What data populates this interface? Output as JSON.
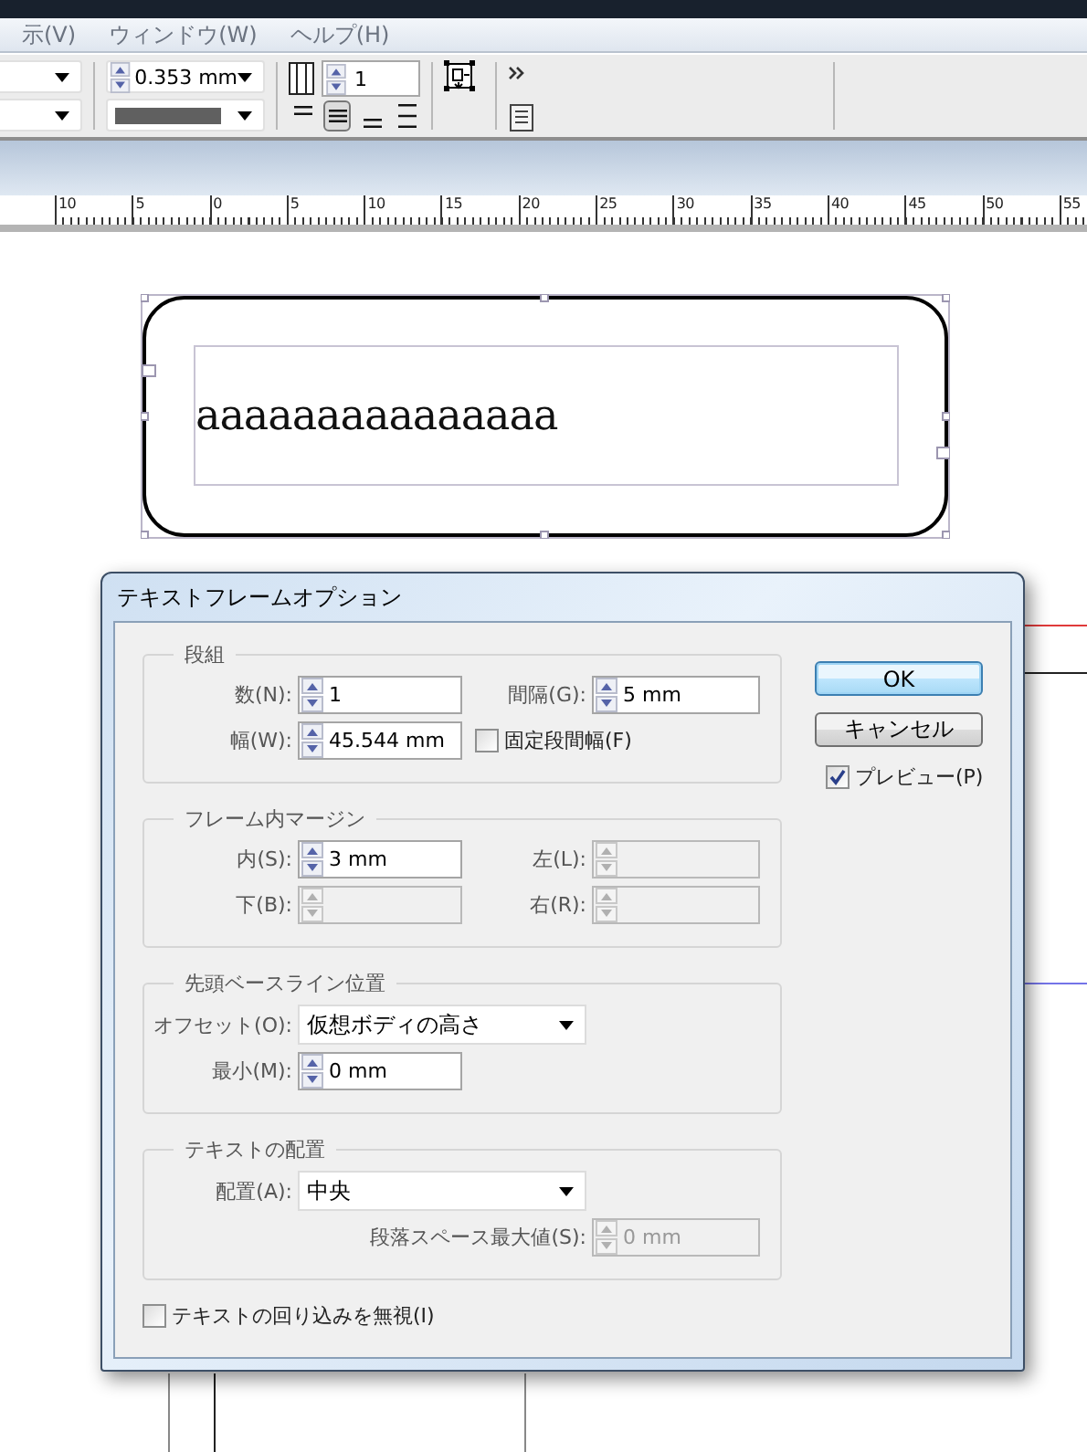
{
  "menu_bar": {
    "items": [
      "示(V)",
      "ウィンドウ(W)",
      "ヘルプ(H)"
    ]
  },
  "control_panel": {
    "stroke_weight": "0.353 mm",
    "column_count": "1",
    "alignment_buttons": [
      {
        "kind": "top",
        "selected": false
      },
      {
        "kind": "center",
        "selected": true
      },
      {
        "kind": "bottom",
        "selected": false
      },
      {
        "kind": "justify",
        "selected": false
      }
    ]
  },
  "ruler": {
    "labels": [
      "10",
      "5",
      "0",
      "5",
      "10",
      "15",
      "20",
      "25",
      "30",
      "35",
      "40",
      "45",
      "50",
      "55"
    ]
  },
  "canvas": {
    "frame_text": "aaaaaaaaaaaaaaa"
  },
  "dialog": {
    "title": "テキストフレームオプション",
    "sections": [
      {
        "title": "段組",
        "rows": [
          {
            "left": {
              "kind": "spin",
              "label": "数(N):",
              "value": "1",
              "disabled": false
            },
            "right": {
              "kind": "spin",
              "label": "間隔(G):",
              "value": "5 mm",
              "disabled": false
            }
          },
          {
            "left": {
              "kind": "spin",
              "label": "幅(W):",
              "value": "45.544 mm",
              "disabled": false
            },
            "right": {
              "kind": "checkbox",
              "label": "固定段間幅(F)",
              "checked": false
            }
          }
        ]
      },
      {
        "title": "フレーム内マージン",
        "rows": [
          {
            "left": {
              "kind": "spin",
              "label": "内(S):",
              "value": "3 mm",
              "disabled": false
            },
            "right": {
              "kind": "spin",
              "label": "左(L):",
              "disabled": true
            }
          },
          {
            "left": {
              "kind": "spin",
              "label": "下(B):",
              "disabled": true
            },
            "right": {
              "kind": "spin",
              "label": "右(R):",
              "disabled": true
            }
          }
        ]
      },
      {
        "title": "先頭ベースライン位置",
        "rows": [
          {
            "left": {
              "kind": "select",
              "label": "オフセット(O):",
              "value": "仮想ボディの高さ"
            }
          },
          {
            "left": {
              "kind": "spin",
              "label": "最小(M):",
              "value": "0 mm",
              "disabled": false
            }
          }
        ]
      },
      {
        "title": "テキストの配置",
        "rows": [
          {
            "left": {
              "kind": "select",
              "label": "配置(A):",
              "value": "中央"
            }
          },
          {
            "right": {
              "kind": "spin",
              "label": "段落スペース最大値(S):",
              "value": "0 mm",
              "disabled": true
            }
          }
        ]
      }
    ],
    "buttons": [
      {
        "label": "OK",
        "default": true
      },
      {
        "label": "キャンセル",
        "default": false
      }
    ],
    "preview": {
      "label": "プレビュー(P)",
      "checked": true
    },
    "ignore_wrap": {
      "label": "テキストの回り込みを無視(I)",
      "checked": false
    }
  }
}
